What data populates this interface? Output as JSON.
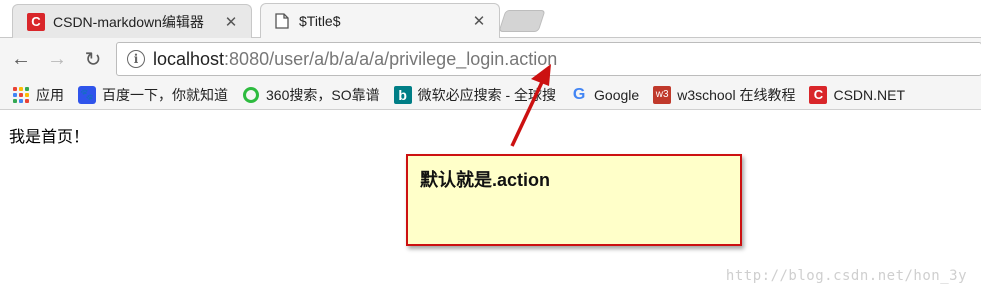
{
  "tabs": [
    {
      "title": "CSDN-markdown编辑器",
      "favicon": "csdn-icon",
      "active": false
    },
    {
      "title": "$Title$",
      "favicon": "page-icon",
      "active": true
    }
  ],
  "tab_close_glyph": "✕",
  "nav": {
    "back": "←",
    "forward": "→",
    "reload": "↻"
  },
  "address": {
    "info_glyph": "i",
    "host": "localhost",
    "rest": ":8080/user/a/b/a/a/a/privilege_login.action"
  },
  "bookmarks": [
    {
      "label": "应用",
      "icon": "apps-icon"
    },
    {
      "label": "百度一下，你就知道",
      "icon": "baidu-icon"
    },
    {
      "label": "360搜索，SO靠谱",
      "icon": "360-icon"
    },
    {
      "label": "微软必应搜索 - 全球搜",
      "icon": "bing-icon"
    },
    {
      "label": "Google",
      "icon": "google-icon"
    },
    {
      "label": "w3school 在线教程",
      "icon": "w3school-icon"
    },
    {
      "label": "CSDN.NET",
      "icon": "csdn-icon"
    }
  ],
  "page": {
    "text": "我是首页！"
  },
  "callout": {
    "text": "默认就是.action"
  },
  "watermark": "http://blog.csdn.net/hon_3y",
  "colors": {
    "callout_border": "#cc1111",
    "callout_bg": "#ffffc9",
    "csdn_red": "#d9262a"
  }
}
